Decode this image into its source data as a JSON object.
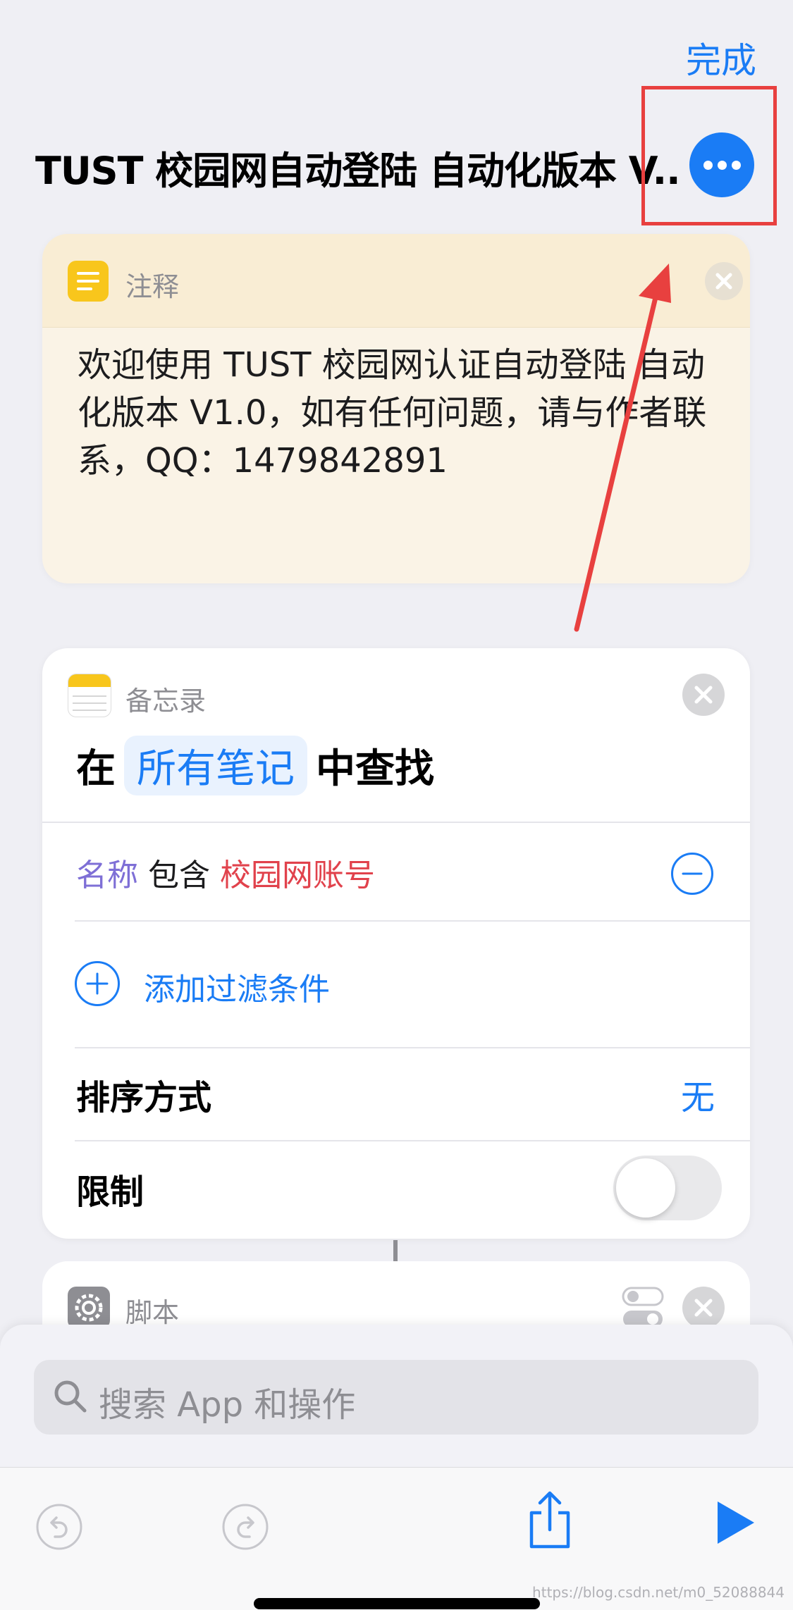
{
  "header": {
    "done_label": "完成",
    "title": "TUST 校园网自动登陆 自动化版本 V..."
  },
  "comment_card": {
    "label": "注释",
    "text": "欢迎使用 TUST 校园网认证自动登陆 自动化版本 V1.0，如有任何问题，请与作者联系，QQ：1479842891"
  },
  "notes_card": {
    "label": "备忘录",
    "sentence_prefix": "在",
    "token": "所有笔记",
    "sentence_suffix": "中查找",
    "filter": {
      "key": "名称",
      "op": "包含",
      "value": "校园网账号"
    },
    "add_filter_label": "添加过滤条件",
    "sort_label": "排序方式",
    "sort_value": "无",
    "limit_label": "限制",
    "limit_on": false
  },
  "script_card": {
    "label": "脚本"
  },
  "search": {
    "placeholder": "搜索 App 和操作"
  },
  "watermark": "https://blog.csdn.net/m0_52088844",
  "colors": {
    "accent": "#1a7cf5",
    "highlight": "#e8403f",
    "comment_bg": "#faf3e6",
    "filter_key": "#7e6fd6",
    "filter_value": "#e1424c"
  },
  "icons": [
    "ellipsis-icon",
    "note-icon",
    "notes-app-icon",
    "close-icon",
    "minus-circle-icon",
    "plus-circle-icon",
    "gear-icon",
    "switch-icon",
    "search-icon",
    "undo-icon",
    "redo-icon",
    "share-icon",
    "play-icon",
    "arrow-annotation"
  ]
}
